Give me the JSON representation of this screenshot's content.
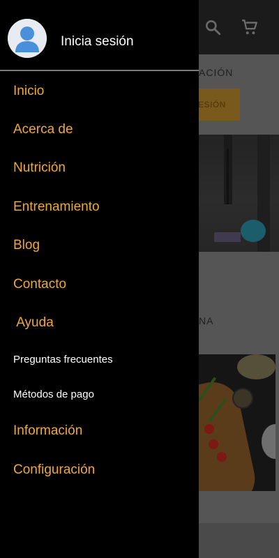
{
  "drawer": {
    "header": {
      "avatar_icon": "user-avatar-icon",
      "login_label": "Inicia sesión"
    },
    "items": [
      {
        "label": "Inicio",
        "type": "primary"
      },
      {
        "label": "Acerca de",
        "type": "primary"
      },
      {
        "label": "Nutrición",
        "type": "primary"
      },
      {
        "label": "Entrenamiento",
        "type": "primary"
      },
      {
        "label": "Blog",
        "type": "primary"
      },
      {
        "label": "Contacto",
        "type": "primary"
      },
      {
        "label": " Ayuda",
        "type": "primary"
      },
      {
        "label": "Preguntas frecuentes",
        "type": "sub"
      },
      {
        "label": "Métodos de pago",
        "type": "sub"
      },
      {
        "label": "Información",
        "type": "primary"
      },
      {
        "label": "Configuración",
        "type": "primary"
      }
    ],
    "colors": {
      "background": "#000000",
      "primary_text": "#f0a839",
      "sub_text": "#ffffff"
    }
  },
  "background_page": {
    "topbar_icons": [
      "search-icon",
      "cart-icon"
    ],
    "section1_text": "ACIÓN",
    "button_text": "ESIÓN",
    "section2_text": "NA",
    "accent_color": "#f0a839"
  }
}
